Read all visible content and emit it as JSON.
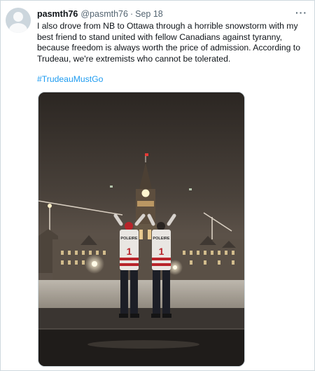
{
  "tweet": {
    "display_name": "pasmth76",
    "handle": "@pasmth76",
    "separator": "·",
    "date": "Sep 18",
    "more_label": "···",
    "text": "I also drove from NB to Ottawa through a horrible snowstorm with my best friend to stand united with fellow Canadians against tyranny, because freedom is always worth the price of admission. According to Trudeau, we're extremists who cannot be tolerated.",
    "hashtag": "#TrudeauMustGo"
  },
  "photo": {
    "jersey_text_left": "POLEIRE",
    "jersey_number_left": "1",
    "jersey_text_right": "POLEIRE",
    "jersey_number_right": "1"
  },
  "colors": {
    "link": "#1d9bf0",
    "secondary_text": "#536471",
    "border": "#cfd9de"
  }
}
